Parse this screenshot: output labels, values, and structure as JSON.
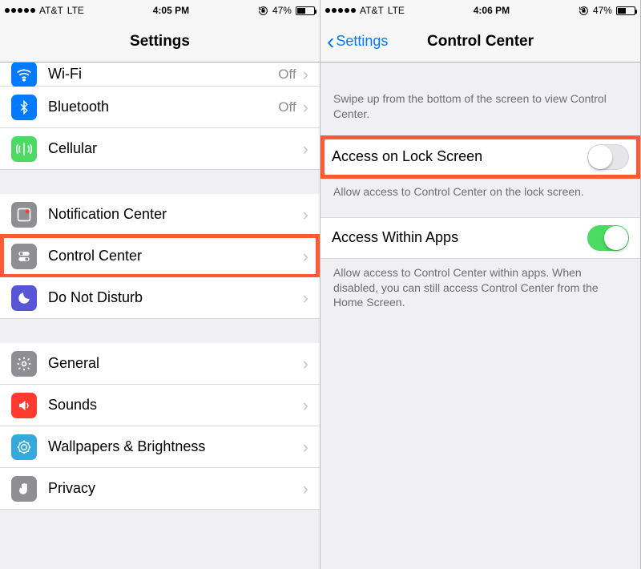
{
  "left": {
    "status": {
      "carrier": "AT&T",
      "network": "LTE",
      "time": "4:05 PM",
      "battery": "47%"
    },
    "nav": {
      "title": "Settings"
    },
    "rows": {
      "wifi": {
        "label": "Wi-Fi",
        "value": "Off"
      },
      "bt": {
        "label": "Bluetooth",
        "value": "Off"
      },
      "cell": {
        "label": "Cellular",
        "value": ""
      },
      "notif": {
        "label": "Notification Center"
      },
      "cc": {
        "label": "Control Center"
      },
      "dnd": {
        "label": "Do Not Disturb"
      },
      "general": {
        "label": "General"
      },
      "sounds": {
        "label": "Sounds"
      },
      "wall": {
        "label": "Wallpapers & Brightness"
      },
      "privacy": {
        "label": "Privacy"
      }
    }
  },
  "right": {
    "status": {
      "carrier": "AT&T",
      "network": "LTE",
      "time": "4:06 PM",
      "battery": "47%"
    },
    "nav": {
      "back": "Settings",
      "title": "Control Center"
    },
    "sections": {
      "intro": "Swipe up from the bottom of the screen to view Control Center.",
      "lock": {
        "label": "Access on Lock Screen",
        "on": false
      },
      "lock_footer": "Allow access to Control Center on the lock screen.",
      "apps": {
        "label": "Access Within Apps",
        "on": true
      },
      "apps_footer": "Allow access to Control Center within apps. When disabled, you can still access Control Center from the Home Screen."
    }
  }
}
